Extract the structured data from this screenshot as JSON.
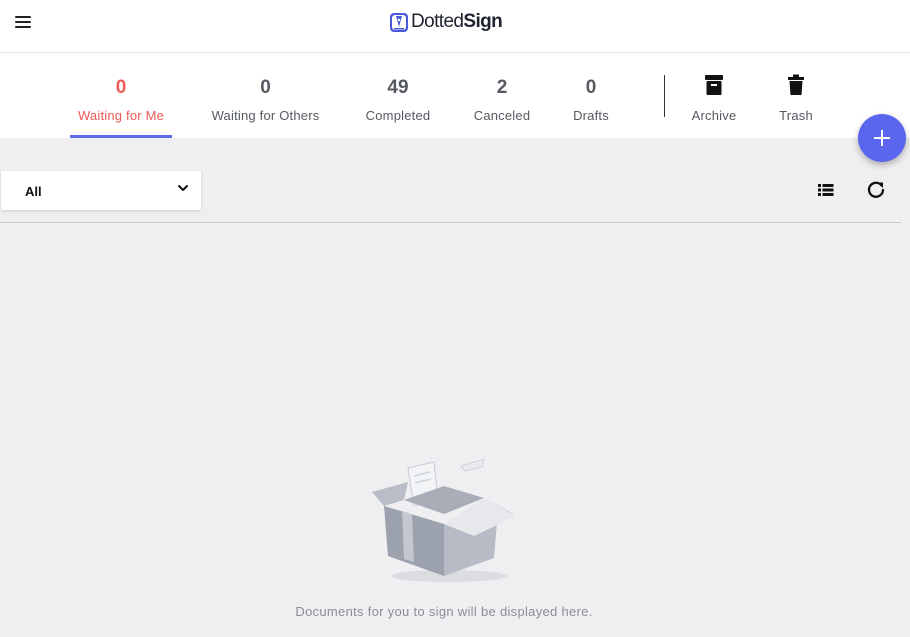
{
  "app": {
    "logo_text_part1": "Dotted",
    "logo_text_part2": "Sign",
    "icons": {
      "menu": "hamburger-menu-icon",
      "logo": "dottedsign-logo-mark"
    }
  },
  "tabs": [
    {
      "count": "0",
      "label": "Waiting for Me",
      "active": true
    },
    {
      "count": "0",
      "label": "Waiting for Others",
      "active": false
    },
    {
      "count": "49",
      "label": "Completed",
      "active": false
    },
    {
      "count": "2",
      "label": "Canceled",
      "active": false
    },
    {
      "count": "0",
      "label": "Drafts",
      "active": false
    }
  ],
  "folders": [
    {
      "label": "Archive",
      "icon": "archive-box-icon"
    },
    {
      "label": "Trash",
      "icon": "trash-can-icon"
    }
  ],
  "fab": {
    "icon": "plus-icon"
  },
  "filter": {
    "value": "All",
    "icon": "chevron-down-icon"
  },
  "toolbar": {
    "view_icon": "list-view-icon",
    "refresh_icon": "refresh-icon"
  },
  "empty_state": {
    "message": "Documents for you to sign will be displayed here.",
    "illustration": "open-box-illustration"
  },
  "colors": {
    "active_text": "#ee5a55",
    "active_underline": "#5b6cf0",
    "fab": "#5a66ee",
    "page_background": "#efeff1"
  }
}
